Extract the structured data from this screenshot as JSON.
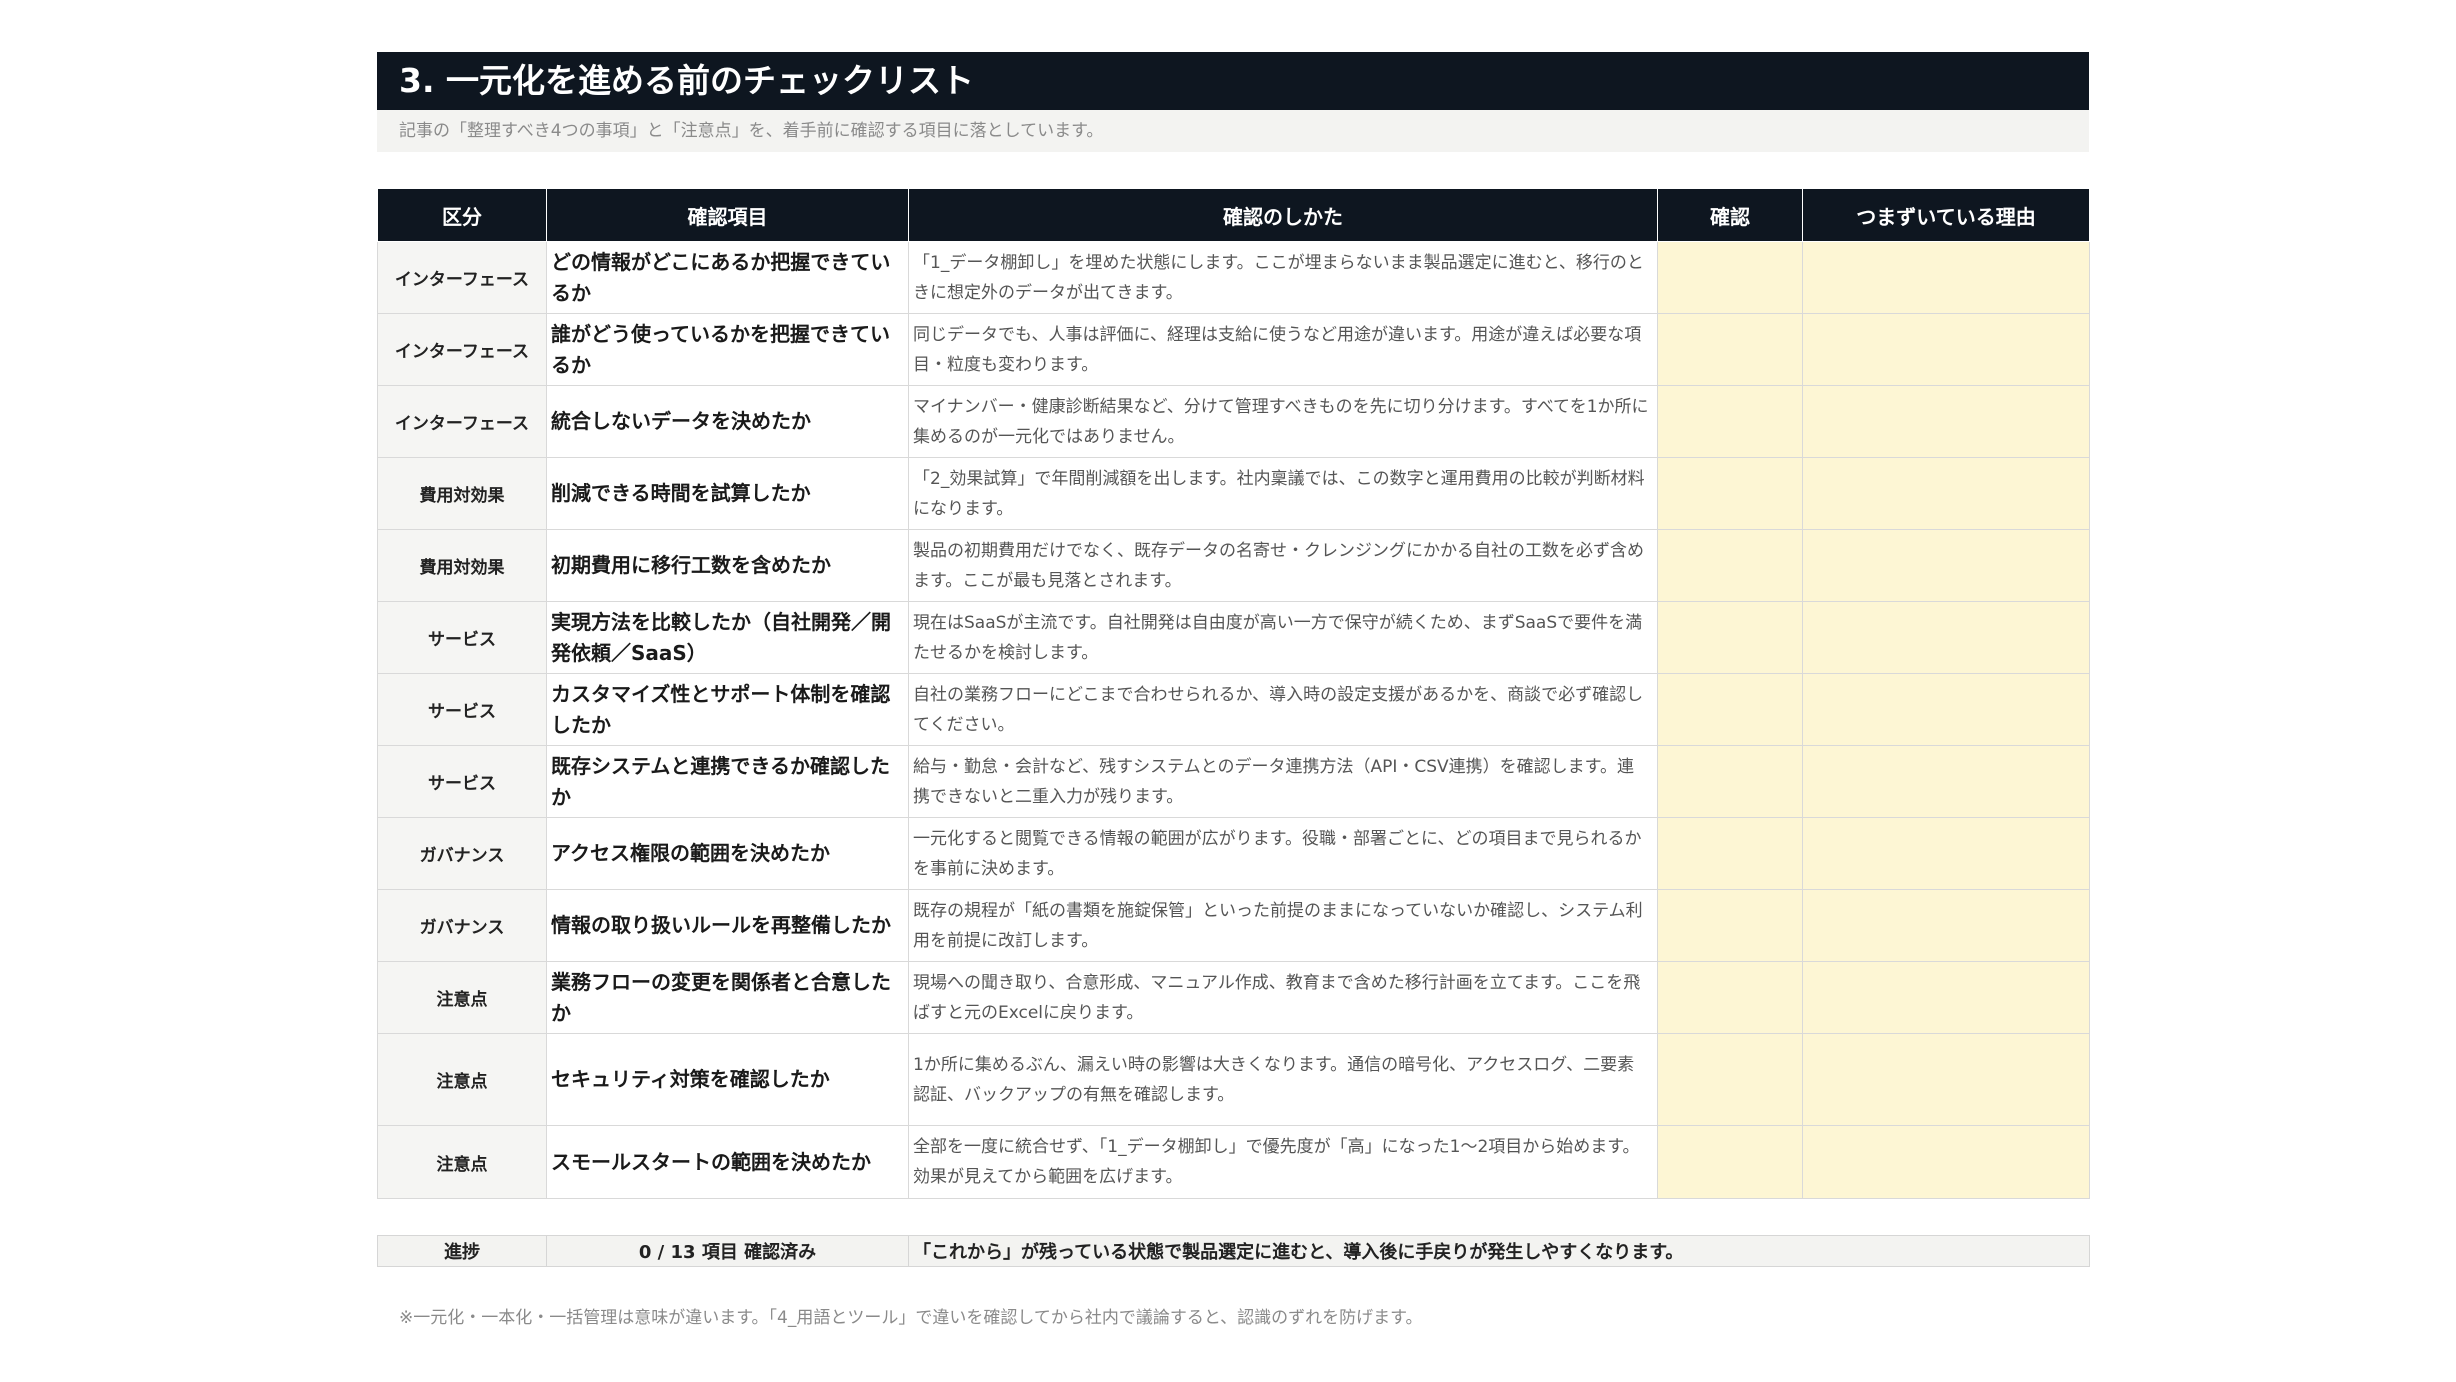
{
  "header": {
    "title": "3. 一元化を進める前のチェックリスト",
    "subtitle": "記事の「整理すべき4つの事項」と「注意点」を、着手前に確認する項目に落としています。"
  },
  "table": {
    "columns": [
      "区分",
      "確認項目",
      "確認のしかた",
      "確認",
      "つまずいている理由"
    ],
    "rows": [
      {
        "category": "インターフェース",
        "item": "どの情報がどこにあるか把握できているか",
        "how": "「1_データ棚卸し」を埋めた状態にします。ここが埋まらないまま製品選定に進むと、移行のときに想定外のデータが出てきます。",
        "check": "",
        "reason": ""
      },
      {
        "category": "インターフェース",
        "item": "誰がどう使っているかを把握できているか",
        "how": "同じデータでも、人事は評価に、経理は支給に使うなど用途が違います。用途が違えば必要な項目・粒度も変わります。",
        "check": "",
        "reason": ""
      },
      {
        "category": "インターフェース",
        "item": "統合しないデータを決めたか",
        "how": "マイナンバー・健康診断結果など、分けて管理すべきものを先に切り分けます。すべてを1か所に集めるのが一元化ではありません。",
        "check": "",
        "reason": ""
      },
      {
        "category": "費用対効果",
        "item": "削減できる時間を試算したか",
        "how": "「2_効果試算」で年間削減額を出します。社内稟議では、この数字と運用費用の比較が判断材料になります。",
        "check": "",
        "reason": ""
      },
      {
        "category": "費用対効果",
        "item": "初期費用に移行工数を含めたか",
        "how": "製品の初期費用だけでなく、既存データの名寄せ・クレンジングにかかる自社の工数を必ず含めます。ここが最も見落とされます。",
        "check": "",
        "reason": ""
      },
      {
        "category": "サービス",
        "item": "実現方法を比較したか（自社開発／開発依頼／SaaS）",
        "how": "現在はSaaSが主流です。自社開発は自由度が高い一方で保守が続くため、まずSaaSで要件を満たせるかを検討します。",
        "check": "",
        "reason": ""
      },
      {
        "category": "サービス",
        "item": "カスタマイズ性とサポート体制を確認したか",
        "how": "自社の業務フローにどこまで合わせられるか、導入時の設定支援があるかを、商談で必ず確認してください。",
        "check": "",
        "reason": ""
      },
      {
        "category": "サービス",
        "item": "既存システムと連携できるか確認したか",
        "how": "給与・勤怠・会計など、残すシステムとのデータ連携方法（API・CSV連携）を確認します。連携できないと二重入力が残ります。",
        "check": "",
        "reason": ""
      },
      {
        "category": "ガバナンス",
        "item": "アクセス権限の範囲を決めたか",
        "how": "一元化すると閲覧できる情報の範囲が広がります。役職・部署ごとに、どの項目まで見られるかを事前に決めます。",
        "check": "",
        "reason": ""
      },
      {
        "category": "ガバナンス",
        "item": "情報の取り扱いルールを再整備したか",
        "how": "既存の規程が「紙の書類を施錠保管」といった前提のままになっていないか確認し、システム利用を前提に改訂します。",
        "check": "",
        "reason": ""
      },
      {
        "category": "注意点",
        "item": "業務フローの変更を関係者と合意したか",
        "how": "現場への聞き取り、合意形成、マニュアル作成、教育まで含めた移行計画を立てます。ここを飛ばすと元のExcelに戻ります。",
        "check": "",
        "reason": ""
      },
      {
        "category": "注意点",
        "item": "セキュリティ対策を確認したか",
        "how": "1か所に集めるぶん、漏えい時の影響は大きくなります。通信の暗号化、アクセスログ、二要素認証、バックアップの有無を確認します。",
        "check": "",
        "reason": ""
      },
      {
        "category": "注意点",
        "item": "スモールスタートの範囲を決めたか",
        "how": "全部を一度に統合せず、「1_データ棚卸し」で優先度が「高」になった1〜2項目から始めます。効果が見えてから範囲を広げます。",
        "check": "",
        "reason": ""
      }
    ]
  },
  "progress": {
    "label": "進捗",
    "count": "0 / 13 項目 確認済み",
    "note": "「これから」が残っている状態で製品選定に進むと、導入後に手戻りが発生しやすくなります。"
  },
  "footnote": "※一元化・一本化・一括管理は意味が違います。「4_用語とツール」で違いを確認してから社内で議論すると、認識のずれを防げます。"
}
